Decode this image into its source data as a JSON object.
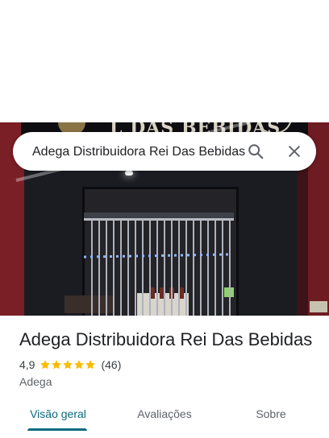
{
  "search": {
    "query": "Adega Distribuidora Rei Das Bebidas",
    "search_icon": "search-icon",
    "close_icon": "close-icon"
  },
  "photo": {
    "sign_text": "L DAS BEBIDAS"
  },
  "place": {
    "title": "Adega Distribuidora Rei Das Bebidas",
    "rating": "4,9",
    "stars": 5,
    "reviews_count": "(46)",
    "category": "Adega"
  },
  "tabs": [
    {
      "label": "Visão geral",
      "active": true
    },
    {
      "label": "Avaliações",
      "active": false
    },
    {
      "label": "Sobre",
      "active": false
    }
  ],
  "colors": {
    "accent": "#0b6b7e",
    "star": "#fbbc04",
    "text_primary": "#202124",
    "text_secondary": "#5f6368"
  }
}
